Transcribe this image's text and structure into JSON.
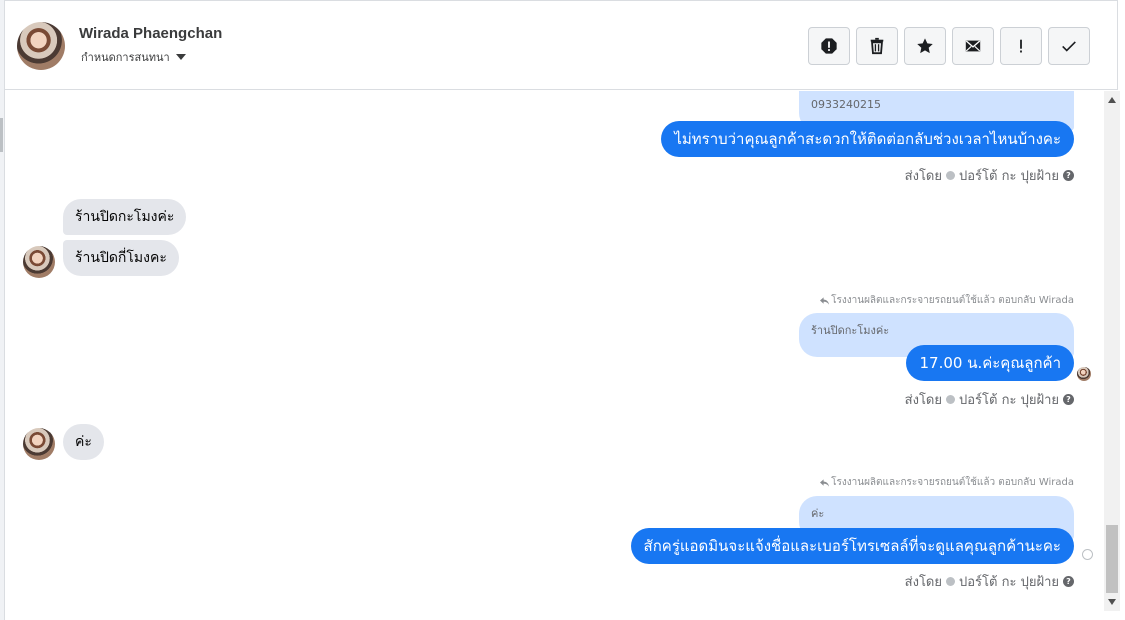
{
  "header": {
    "name": "Wirada Phaengchan",
    "assign_label": "กำหนดการสนทนา"
  },
  "toolbar": [
    {
      "name": "spam-icon"
    },
    {
      "name": "trash-icon"
    },
    {
      "name": "star-icon"
    },
    {
      "name": "mail-icon"
    },
    {
      "name": "exclamation-icon"
    },
    {
      "name": "checkmark-icon"
    }
  ],
  "thread": {
    "quote_phone": "0933240215",
    "msg1": "ไม่ทราบว่าคุณลูกค้าสะดวกให้ติดต่อกลับช่วงเวลาไหนบ้างคะ",
    "sent_by_1": "ส่งโดย",
    "sender_1": "ปอร์โต้ กะ ปุยฝ้าย",
    "in1": "ร้านปิดกะโมงค่ะ",
    "in2": "ร้านปิดกี่โมงคะ",
    "reply_note_1": "โรงงานผลิตและกระจายรถยนต์ใช้แล้ว ตอบกลับ Wirada",
    "quote_2": "ร้านปิดกะโมงค่ะ",
    "msg2": "17.00 น.ค่ะคุณลูกค้า",
    "sent_by_2": "ส่งโดย",
    "sender_2": "ปอร์โต้ กะ ปุยฝ้าย",
    "in3": "ค่ะ",
    "reply_note_2": "โรงงานผลิตและกระจายรถยนต์ใช้แล้ว ตอบกลับ Wirada",
    "quote_3": "ค่ะ",
    "msg3": "สักครู่แอดมินจะแจ้งชื่อและเบอร์โทรเซลล์ที่จะดูแลคุณลูกค้านะคะ",
    "sent_by_3": "ส่งโดย",
    "sender_3": "ปอร์โต้ กะ ปุยฝ้าย"
  },
  "colors": {
    "outgoing_bubble": "#1877f2",
    "quote_bubble": "#cfe2ff",
    "incoming_bubble": "#e4e6eb"
  }
}
